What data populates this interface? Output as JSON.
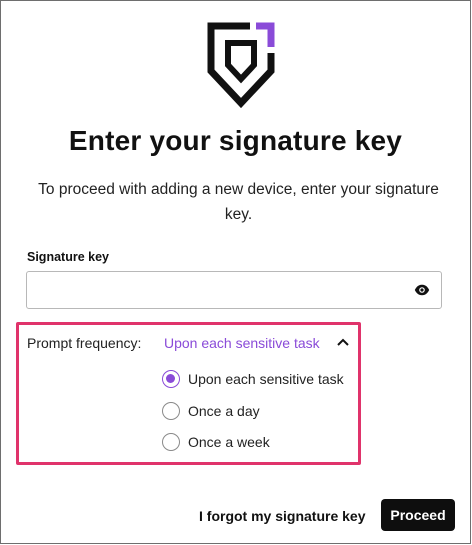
{
  "header": {
    "logo_icon": "shield-logo-icon",
    "title": "Enter your signature key",
    "subtitle": "To proceed with adding a new device, enter your signature key."
  },
  "signature_key": {
    "label": "Signature key",
    "value": "",
    "placeholder": "",
    "toggle_icon": "eye-icon"
  },
  "prompt_frequency": {
    "label": "Prompt frequency:",
    "selected": "Upon each sensitive task",
    "expanded": true,
    "options": [
      {
        "label": "Upon each sensitive task",
        "checked": true
      },
      {
        "label": "Once a day",
        "checked": false
      },
      {
        "label": "Once a week",
        "checked": false
      }
    ]
  },
  "footer": {
    "forgot_label": "I forgot my signature key",
    "proceed_label": "Proceed"
  },
  "colors": {
    "accent": "#8a4bd8",
    "highlight": "#e0336b",
    "button_bg": "#0e0e0e"
  }
}
